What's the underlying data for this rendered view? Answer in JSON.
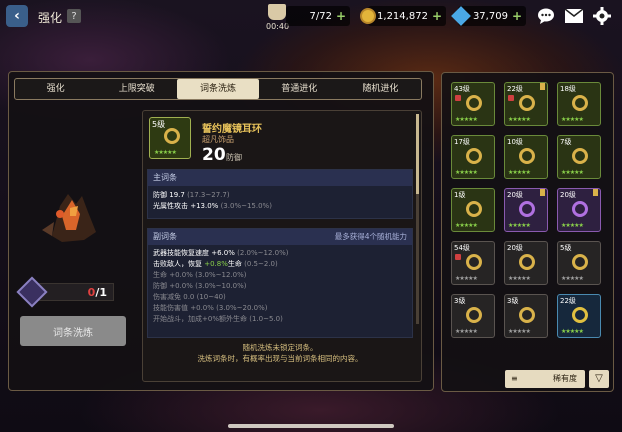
{
  "header": {
    "back_icon": "‹",
    "title": "强化",
    "help_label": "?",
    "stamina": "7/72",
    "stamina_timer": "00:40",
    "gold": "1,214,872",
    "gems": "37,709",
    "plus": "+"
  },
  "tabs": [
    {
      "label": "强化",
      "active": false
    },
    {
      "label": "上限突破",
      "active": false
    },
    {
      "label": "词条洗炼",
      "active": true
    },
    {
      "label": "普通进化",
      "active": false
    },
    {
      "label": "随机进化",
      "active": false
    }
  ],
  "hero": {
    "level_value": "0",
    "level_max": "/1",
    "reroll_button": "词条洗炼"
  },
  "item": {
    "tier": "5级",
    "name": "誓约魔镜耳环",
    "rarity": "超凡饰品",
    "value": "20",
    "value_label": "防御",
    "stars": "★★★★★"
  },
  "main_stats": {
    "title": "主词条",
    "rows": [
      {
        "name": "防御",
        "value": "19.7",
        "range": "(17.3~27.7)"
      },
      {
        "name": "光属性攻击",
        "value": "+13.0%",
        "range": "(3.0%~15.0%)"
      }
    ]
  },
  "sub_stats": {
    "title": "副词条",
    "hint": "最多获得4个随机能力",
    "rows": [
      {
        "name": "武器技能恢复速度",
        "value": "+6.0%",
        "range": "(2.0%~12.0%)",
        "active": true
      },
      {
        "name": "击败敌人，恢复",
        "value": "+0.8%",
        "suffix": "生命",
        "range": "(0.5~2.0)",
        "active": true,
        "green": true
      },
      {
        "name": "生命",
        "value": "+0.0%",
        "range": "(3.0%~12.0%)",
        "active": false
      },
      {
        "name": "防御",
        "value": "+0.0%",
        "range": "(3.0%~10.0%)",
        "active": false
      },
      {
        "name": "伤害减免",
        "value": "0.0",
        "range": "(10~40)",
        "active": false
      },
      {
        "name": "技能伤害值",
        "value": "+0.0%",
        "range": "(3.0%~20.0%)",
        "active": false
      },
      {
        "name": "开始战斗，加成+0%额外生命",
        "value": "",
        "range": "(1.0~5.0)",
        "active": false
      }
    ]
  },
  "footnote": [
    "随机洗炼未锁定词条。",
    "洗炼词条时，有概率出现与当前词条相同的内容。"
  ],
  "inventory": [
    {
      "tier": "43级",
      "style": "green",
      "lock": true,
      "flag": false
    },
    {
      "tier": "22级",
      "style": "green",
      "lock": true,
      "flag": true
    },
    {
      "tier": "18级",
      "style": "green",
      "lock": false,
      "flag": false
    },
    {
      "tier": "17级",
      "style": "green",
      "lock": false,
      "flag": false
    },
    {
      "tier": "10级",
      "style": "green",
      "lock": false,
      "flag": false
    },
    {
      "tier": "7级",
      "style": "green",
      "lock": false,
      "flag": false
    },
    {
      "tier": "1级",
      "style": "green",
      "lock": false,
      "flag": false
    },
    {
      "tier": "20级",
      "style": "purple",
      "lock": false,
      "flag": true
    },
    {
      "tier": "20级",
      "style": "purple",
      "lock": false,
      "flag": true
    },
    {
      "tier": "54级",
      "style": "gray",
      "lock": true,
      "flag": false
    },
    {
      "tier": "20级",
      "style": "gray",
      "lock": false,
      "flag": false
    },
    {
      "tier": "5级",
      "style": "gray",
      "lock": false,
      "flag": false
    },
    {
      "tier": "3级",
      "style": "gray",
      "lock": false,
      "flag": false
    },
    {
      "tier": "3级",
      "style": "gray",
      "lock": false,
      "flag": false
    },
    {
      "tier": "22级",
      "style": "blue",
      "lock": false,
      "flag": false
    }
  ],
  "inventory_stars": "★★★★★",
  "sort_label": "稀有度",
  "sort_icon": "≡",
  "filter_icon": "▽",
  "icons": {
    "chat": "chat-icon",
    "mail": "mail-icon",
    "settings": "gear-icon"
  }
}
